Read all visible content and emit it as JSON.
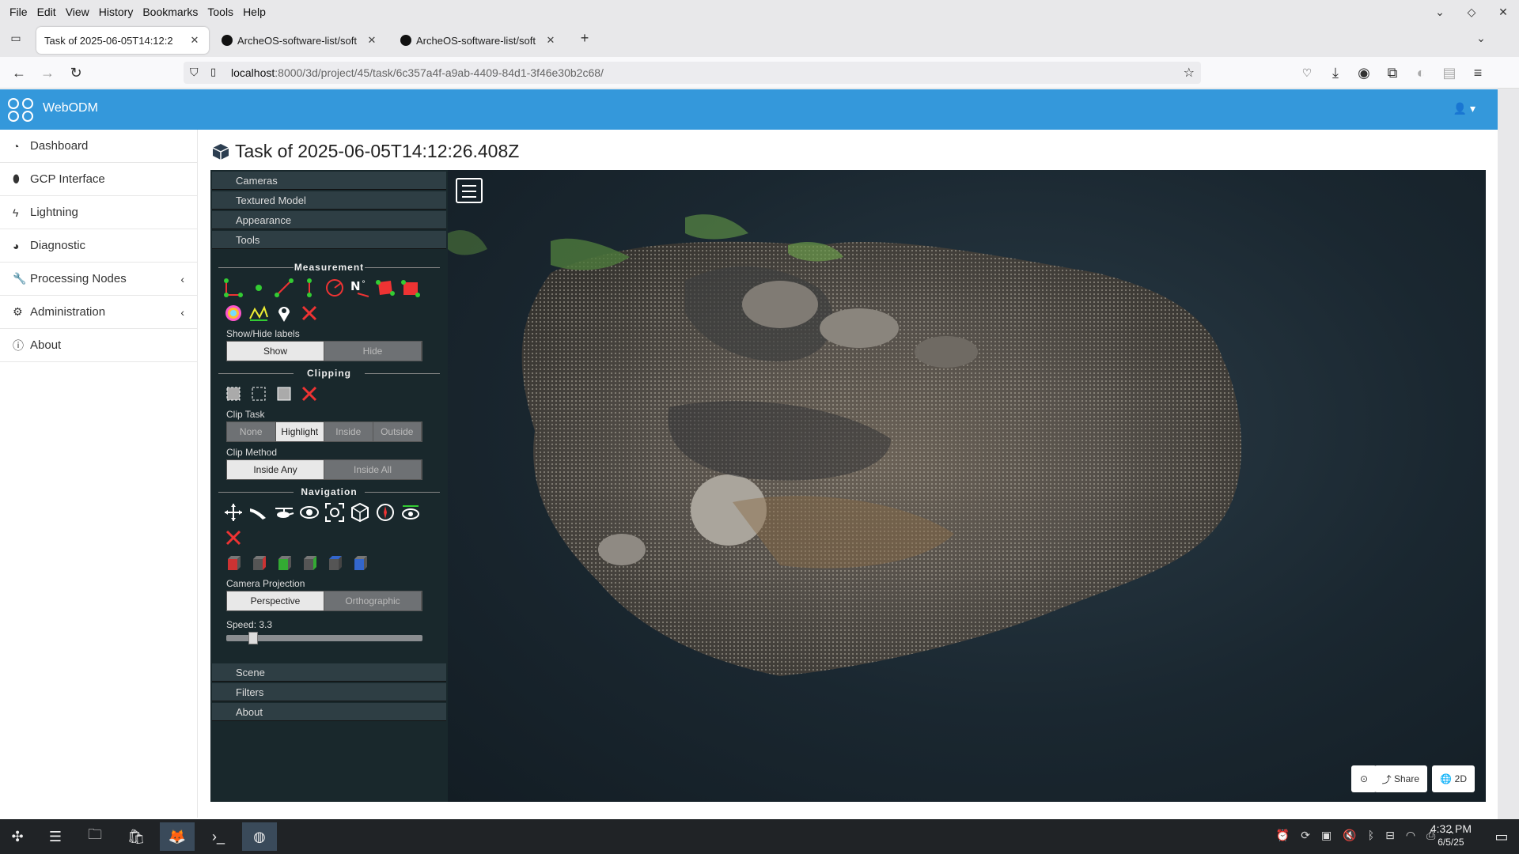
{
  "browser": {
    "menu": [
      "File",
      "Edit",
      "View",
      "History",
      "Bookmarks",
      "Tools",
      "Help"
    ],
    "tabs": [
      {
        "label": "Task of 2025-06-05T14:12:2",
        "active": true
      },
      {
        "label": "ArcheOS-software-list/soft",
        "active": false
      },
      {
        "label": "ArcheOS-software-list/soft",
        "active": false
      }
    ],
    "url_host": "localhost",
    "url_path": ":8000/3d/project/45/task/6c357a4f-a9ab-4409-84d1-3f46e30b2c68/"
  },
  "app": {
    "brand": "WebODM",
    "accent": "#3498db"
  },
  "sidebar": {
    "items": [
      {
        "label": "Dashboard",
        "icon": "dashboard-icon"
      },
      {
        "label": "GCP Interface",
        "icon": "map-marker-icon"
      },
      {
        "label": "Lightning",
        "icon": "bolt-icon"
      },
      {
        "label": "Diagnostic",
        "icon": "pie-chart-icon"
      },
      {
        "label": "Processing Nodes",
        "icon": "wrench-icon",
        "expandable": true
      },
      {
        "label": "Administration",
        "icon": "cogs-icon",
        "expandable": true
      },
      {
        "label": "About",
        "icon": "info-icon"
      }
    ]
  },
  "page": {
    "title": "Task of 2025-06-05T14:12:26.408Z"
  },
  "potree": {
    "top_sections": [
      "Cameras",
      "Textured Model",
      "Appearance",
      "Tools"
    ],
    "measurement": "Measurement",
    "show_hide_label": "Show/Hide labels",
    "show": "Show",
    "hide": "Hide",
    "clipping": "Clipping",
    "clip_task_label": "Clip Task",
    "clip_task_options": [
      "None",
      "Highlight",
      "Inside",
      "Outside"
    ],
    "clip_method_label": "Clip Method",
    "clip_method_options": [
      "Inside Any",
      "Inside All"
    ],
    "navigation": "Navigation",
    "camera_projection_label": "Camera Projection",
    "projection_options": [
      "Perspective",
      "Orthographic"
    ],
    "speed_label": "Speed: 3.3",
    "speed_fraction": 0.12,
    "bottom_sections": [
      "Scene",
      "Filters",
      "About"
    ]
  },
  "viewer_buttons": {
    "share": "Share",
    "twod": "2D"
  },
  "taskbar": {
    "time": "4:32 PM",
    "date": "6/5/25"
  }
}
